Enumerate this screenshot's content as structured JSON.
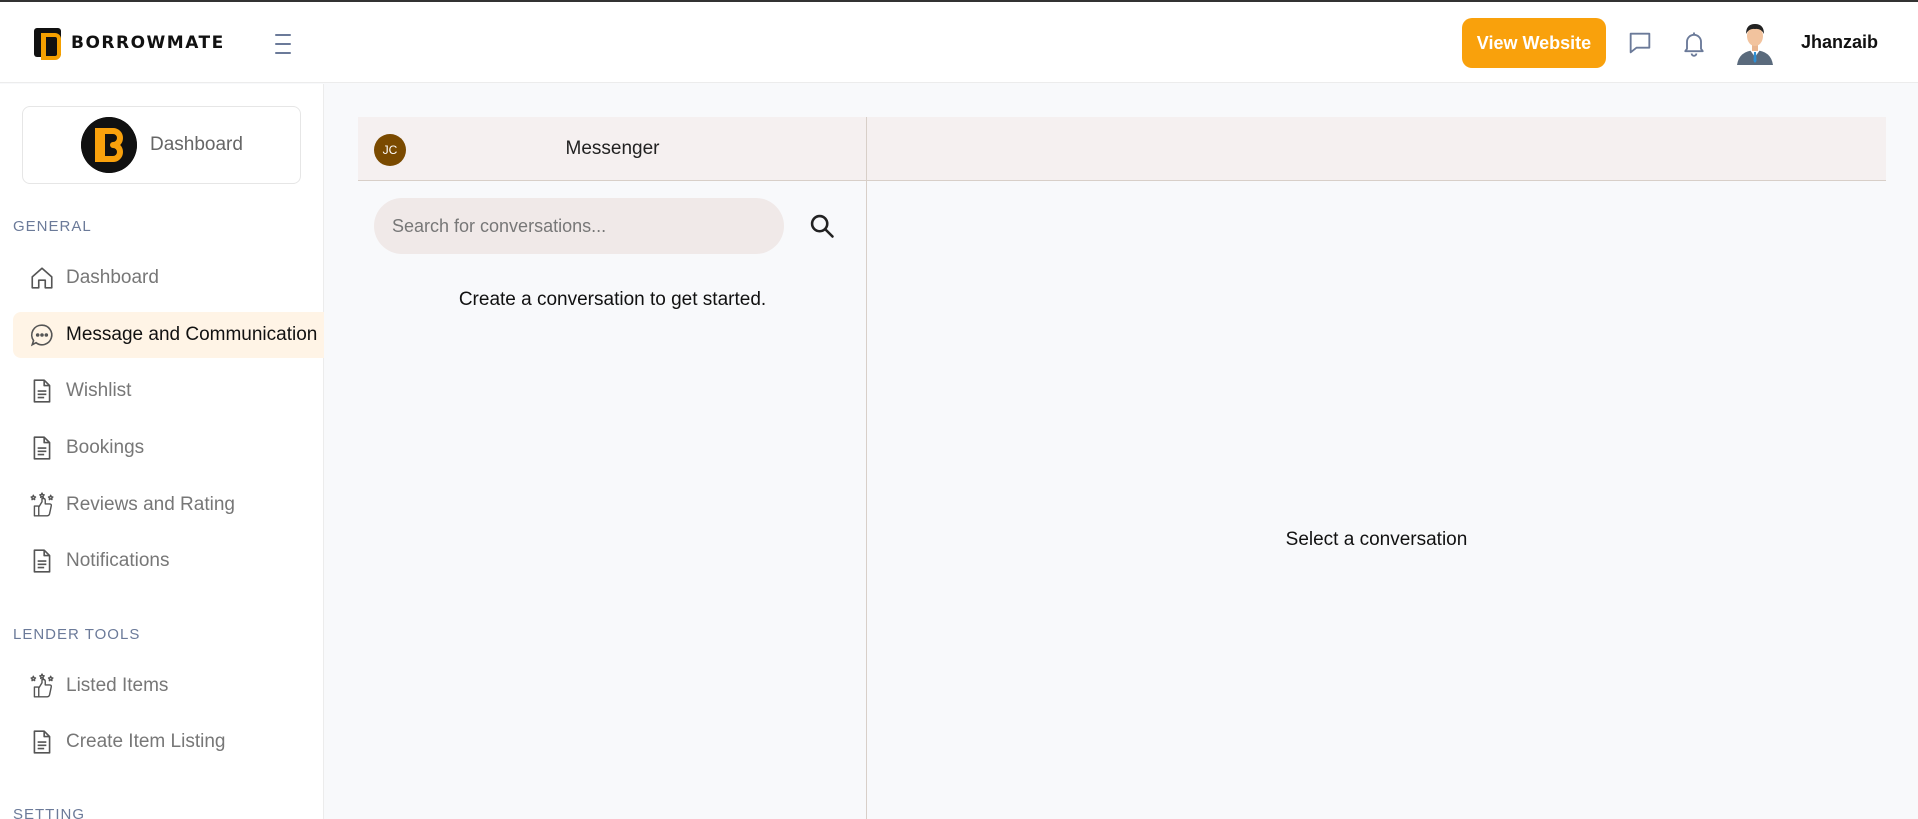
{
  "brand": {
    "name": "BORROWMATE",
    "accent": "#f9a10c"
  },
  "header": {
    "view_website_label": "View Website",
    "icons": [
      "message-icon",
      "bell-icon"
    ],
    "user": {
      "name": "Jhanzaib"
    }
  },
  "sidebar": {
    "dashboard_card_label": "Dashboard",
    "general_title": "GENERAL",
    "general_items": [
      {
        "label": "Dashboard",
        "icon": "home-icon",
        "active": false
      },
      {
        "label": "Message and Communication",
        "icon": "chat-icon",
        "active": true
      },
      {
        "label": "Wishlist",
        "icon": "document-icon",
        "active": false
      },
      {
        "label": "Bookings",
        "icon": "document-icon",
        "active": false
      },
      {
        "label": "Reviews and Rating",
        "icon": "thumbs-up-stars-icon",
        "active": false
      },
      {
        "label": "Notifications",
        "icon": "document-icon",
        "active": false
      }
    ],
    "lender_title": "LENDER TOOLS",
    "lender_items": [
      {
        "label": "Listed Items",
        "icon": "thumbs-up-stars-icon"
      },
      {
        "label": "Create Item Listing",
        "icon": "document-icon"
      }
    ],
    "setting_title": "SETTING"
  },
  "messenger": {
    "avatar_initials": "JC",
    "title": "Messenger",
    "search_placeholder": "Search for conversations...",
    "empty_message": "Create a conversation to get started.",
    "select_message": "Select a conversation"
  }
}
